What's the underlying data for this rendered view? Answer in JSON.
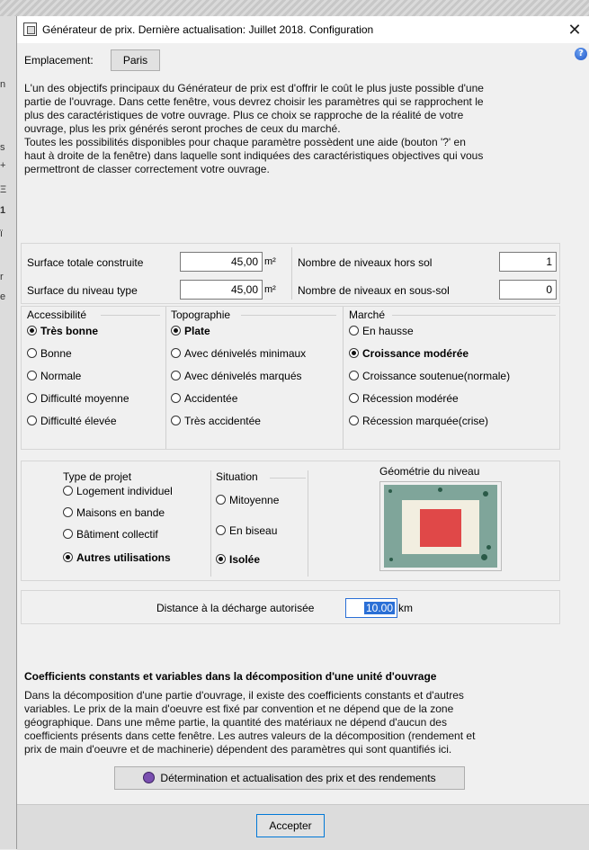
{
  "window": {
    "title": "Générateur de prix. Dernière actualisation: Juillet 2018. Configuration",
    "close_symbol": "✕",
    "help_symbol": "?"
  },
  "background_fragments": [
    "n",
    "s",
    "+",
    "Ξ",
    "1",
    "ï",
    "r",
    "e"
  ],
  "location": {
    "label": "Emplacement:",
    "value": "Paris"
  },
  "intro_lines": [
    "L'un des objectifs principaux du Générateur de prix est d'offrir le coût le plus juste possible d'une",
    "partie de l'ouvrage. Dans cette fenêtre, vous devrez choisir les paramètres qui se rapprochent le",
    "plus des caractéristiques de votre ouvrage. Plus ce choix se rapproche de la réalité de votre",
    "ouvrage, plus les prix générés seront proches de ceux du marché.",
    "Toutes les possibilités disponibles pour chaque paramètre possèdent une aide (bouton '?' en",
    "haut à droite de la fenêtre) dans laquelle sont indiquées des caractéristiques objectives qui vous",
    "permettront de classer correctement votre ouvrage."
  ],
  "surfaces": {
    "total_label": "Surface totale construite",
    "total_value": "45,00",
    "type_label": "Surface du niveau type",
    "type_value": "45,00",
    "unit": "m²",
    "above_label": "Nombre de niveaux hors sol",
    "above_value": "1",
    "below_label": "Nombre de niveaux en sous-sol",
    "below_value": "0"
  },
  "accessibilite": {
    "title": "Accessibilité",
    "options": [
      {
        "label": "Très bonne",
        "selected": true
      },
      {
        "label": "Bonne",
        "selected": false
      },
      {
        "label": "Normale",
        "selected": false
      },
      {
        "label": "Difficulté moyenne",
        "selected": false
      },
      {
        "label": "Difficulté élevée",
        "selected": false
      }
    ]
  },
  "topographie": {
    "title": "Topographie",
    "options": [
      {
        "label": "Plate",
        "selected": true
      },
      {
        "label": "Avec dénivelés minimaux",
        "selected": false
      },
      {
        "label": "Avec dénivelés marqués",
        "selected": false
      },
      {
        "label": "Accidentée",
        "selected": false
      },
      {
        "label": "Très accidentée",
        "selected": false
      }
    ]
  },
  "marche": {
    "title": "Marché",
    "options": [
      {
        "label": "En hausse",
        "selected": false
      },
      {
        "label": "Croissance modérée",
        "selected": true
      },
      {
        "label": "Croissance soutenue(normale)",
        "selected": false
      },
      {
        "label": "Récession modérée",
        "selected": false
      },
      {
        "label": "Récession marquée(crise)",
        "selected": false
      }
    ]
  },
  "type_projet": {
    "title": "Type de projet",
    "options": [
      {
        "label": "Logement individuel",
        "selected": false
      },
      {
        "label": "Maisons en bande",
        "selected": false
      },
      {
        "label": "Bâtiment collectif",
        "selected": false
      },
      {
        "label": "Autres utilisations",
        "selected": true
      }
    ]
  },
  "situation": {
    "title": "Situation",
    "options": [
      {
        "label": "Mitoyenne",
        "selected": false
      },
      {
        "label": "En biseau",
        "selected": false
      },
      {
        "label": "Isolée",
        "selected": true
      }
    ]
  },
  "geometrie": {
    "title": "Géométrie du niveau"
  },
  "distance": {
    "label": "Distance à la décharge autorisée",
    "value": "10.00",
    "unit": "km"
  },
  "coefficients": {
    "heading": "Coefficients constants et variables dans la décomposition d'une unité d'ouvrage",
    "lines": [
      "Dans la décomposition d'une partie d'ouvrage, il existe des coefficients constants et d'autres",
      "variables. Le prix de la main d'oeuvre est fixé par convention et ne dépend que de la zone",
      "géographique. Dans une même partie, la quantité des matériaux ne dépend d'aucun des",
      "coefficients présents dans cette fenêtre. Les autres valeurs de la décomposition (rendement et",
      "prix de main d'oeuvre et de machinerie) dépendent des paramètres qui sont quantifiés ici."
    ]
  },
  "determination_button": "Détermination et actualisation des prix et des rendements",
  "accept_button": "Accepter",
  "colors": {
    "plan_outer": "#7fa59a",
    "plan_inner": "#f2eee0",
    "plan_building": "#e04848",
    "distance_border": "#2a6fd6",
    "distance_selection": "#2a6fd6"
  }
}
